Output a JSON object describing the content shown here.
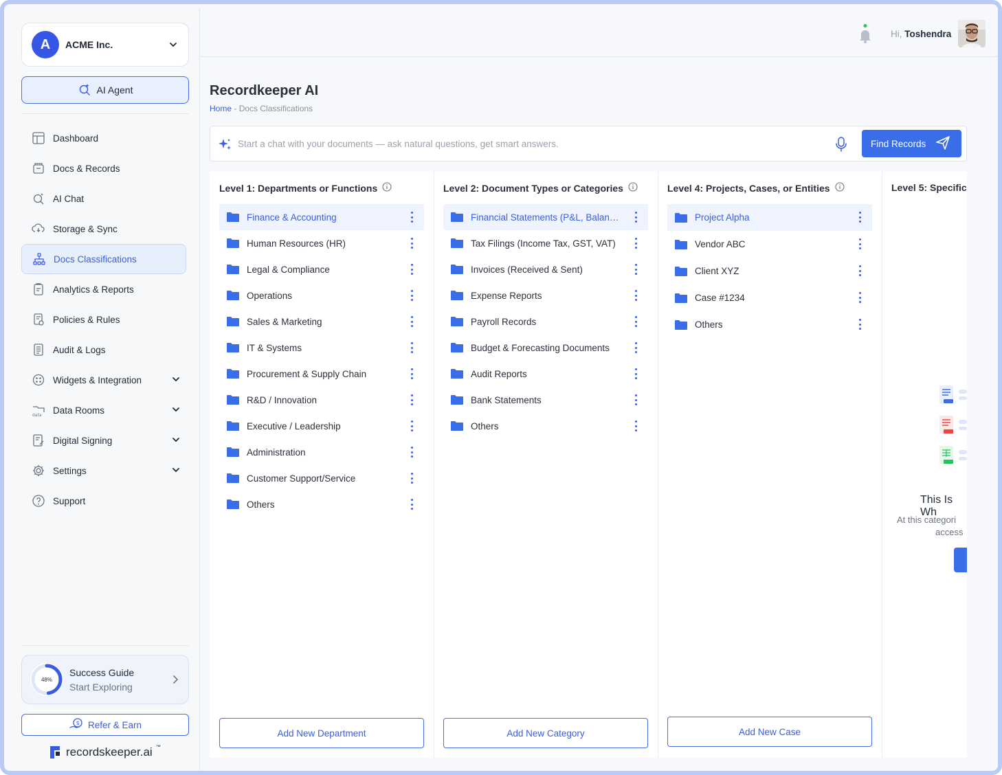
{
  "org": {
    "initial": "A",
    "name": "ACME Inc."
  },
  "ai_agent": {
    "label": "AI Agent"
  },
  "nav": [
    {
      "label": "Dashboard",
      "icon": "dashboard-icon"
    },
    {
      "label": "Docs & Records",
      "icon": "docs-icon"
    },
    {
      "label": "AI Chat",
      "icon": "ai-chat-icon"
    },
    {
      "label": "Storage & Sync",
      "icon": "cloud-sync-icon"
    },
    {
      "label": "Docs Classifications",
      "icon": "hierarchy-icon",
      "active": true
    },
    {
      "label": "Analytics & Reports",
      "icon": "clipboard-icon"
    },
    {
      "label": "Policies & Rules",
      "icon": "policy-icon"
    },
    {
      "label": "Audit & Logs",
      "icon": "list-icon"
    },
    {
      "label": "Widgets & Integration",
      "icon": "widgets-icon",
      "expandable": true
    },
    {
      "label": "Data Rooms",
      "icon": "data-folder-icon",
      "expandable": true
    },
    {
      "label": "Digital Signing",
      "icon": "signing-icon",
      "expandable": true
    },
    {
      "label": "Settings",
      "icon": "gear-icon",
      "expandable": true
    },
    {
      "label": "Support",
      "icon": "help-icon"
    }
  ],
  "success_guide": {
    "percent": "48%",
    "progress": 0.48,
    "title": "Success Guide",
    "subtitle": "Start Exploring"
  },
  "refer": {
    "label": "Refer & Earn"
  },
  "brand": {
    "name": "recordskeeper.ai",
    "tm": "™"
  },
  "header": {
    "greeting": "Hi,",
    "user": "Toshendra"
  },
  "page": {
    "title": "Recordkeeper AI",
    "breadcrumb_home": "Home",
    "breadcrumb_sep": " - ",
    "breadcrumb_current": "Docs Classifications"
  },
  "chat": {
    "placeholder": "Start a chat with your documents — ask natural questions, get smart answers.",
    "button": "Find Records"
  },
  "columns": [
    {
      "title": "Level 1: Departments or Functions",
      "items": [
        "Finance & Accounting",
        "Human Resources (HR)",
        "Legal & Compliance",
        "Operations",
        "Sales & Marketing",
        "IT & Systems",
        "Procurement & Supply Chain",
        "R&D / Innovation",
        "Executive / Leadership",
        "Administration",
        "Customer Support/Service",
        "Others"
      ],
      "active_index": 0,
      "add_label": "Add New Department"
    },
    {
      "title": "Level 2: Document Types or Categories",
      "items": [
        "Financial Statements (P&L, Balance Sheet)",
        "Tax Filings (Income Tax, GST, VAT)",
        "Invoices (Received & Sent)",
        "Expense Reports",
        "Payroll Records",
        "Budget & Forecasting Documents",
        "Audit Reports",
        "Bank Statements",
        "Others"
      ],
      "active_index": 0,
      "add_label": "Add New Category"
    },
    {
      "title": "Level 4: Projects, Cases, or Entities",
      "items": [
        "Project Alpha",
        "Vendor ABC",
        "Client XYZ",
        "Case #1234",
        "Others"
      ],
      "active_index": 0,
      "add_label": "Add New Case"
    },
    {
      "title": "Level 5: Specific",
      "empty_title": "This Is Wh",
      "empty_line1": "At this categori",
      "empty_line2": "access"
    }
  ],
  "colors": {
    "accent": "#3a5de0",
    "button": "#3a6ee8",
    "folder": "#3a6ee8",
    "frame": "#b9cbf5"
  }
}
